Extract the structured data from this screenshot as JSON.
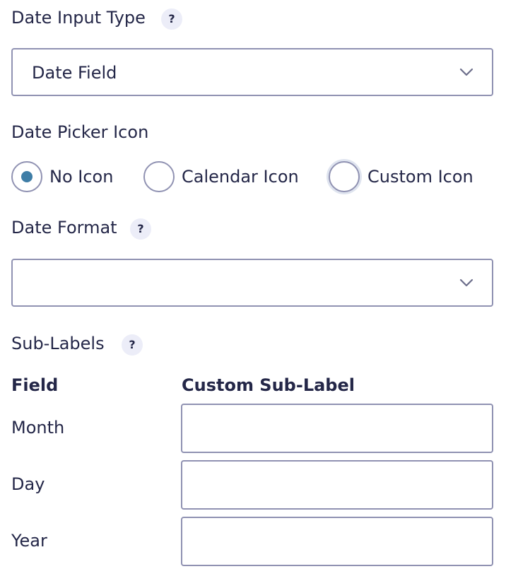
{
  "date_input_type": {
    "label": "Date Input Type",
    "help": "?",
    "selected": "Date Field"
  },
  "date_picker_icon": {
    "label": "Date Picker Icon",
    "options": [
      {
        "label": "No Icon",
        "checked": true
      },
      {
        "label": "Calendar Icon",
        "checked": false
      },
      {
        "label": "Custom Icon",
        "checked": false,
        "focused": true
      }
    ]
  },
  "date_format": {
    "label": "Date Format",
    "help": "?",
    "selected": ""
  },
  "sub_labels": {
    "label": "Sub-Labels",
    "help": "?",
    "columns": [
      "Field",
      "Custom Sub-Label"
    ],
    "rows": [
      {
        "field": "Month",
        "value": ""
      },
      {
        "field": "Day",
        "value": ""
      },
      {
        "field": "Year",
        "value": ""
      }
    ]
  },
  "colors": {
    "text": "#242748",
    "border": "#9092b2",
    "help_bg": "#ecedf8",
    "radio_dot": "#3e7da6"
  }
}
